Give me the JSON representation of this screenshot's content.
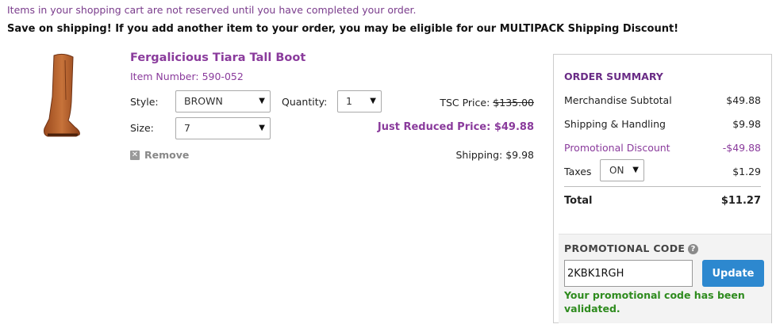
{
  "notice": "Items in your shopping cart are not reserved until you have completed your order.",
  "promo_banner": "Save on shipping! If you add another item to your order, you may be eligible for our MULTIPACK Shipping Discount!",
  "product": {
    "title": "Fergalicious Tiara Tall Boot",
    "item_number": "Item Number: 590-052",
    "style_label": "Style:",
    "style_value": "BROWN",
    "size_label": "Size:",
    "size_value": "7",
    "quantity_label": "Quantity:",
    "quantity_value": "1",
    "tsc_label": "TSC Price:",
    "tsc_value": "$135.00",
    "reduced": "Just Reduced Price: $49.88",
    "shipping": "Shipping: $9.98",
    "remove": "Remove",
    "image_icon": "boot-image"
  },
  "summary": {
    "title": "ORDER SUMMARY",
    "merch_label": "Merchandise Subtotal",
    "merch_value": "$49.88",
    "ship_label": "Shipping & Handling",
    "ship_value": "$9.98",
    "promo_label": "Promotional Discount",
    "promo_value": "-$49.88",
    "taxes_label": "Taxes",
    "taxes_select": "ON",
    "taxes_value": "$1.29",
    "total_label": "Total",
    "total_value": "$11.27",
    "promo_code_label": "PROMOTIONAL CODE",
    "promo_code_value": "2KBK1RGH",
    "update_label": "Update",
    "validated_msg": "Your promotional code has been validated."
  },
  "colors": {
    "accent_purple": "#8a3b9c",
    "button_blue": "#2d88cf",
    "success_green": "#2e8b1e"
  }
}
